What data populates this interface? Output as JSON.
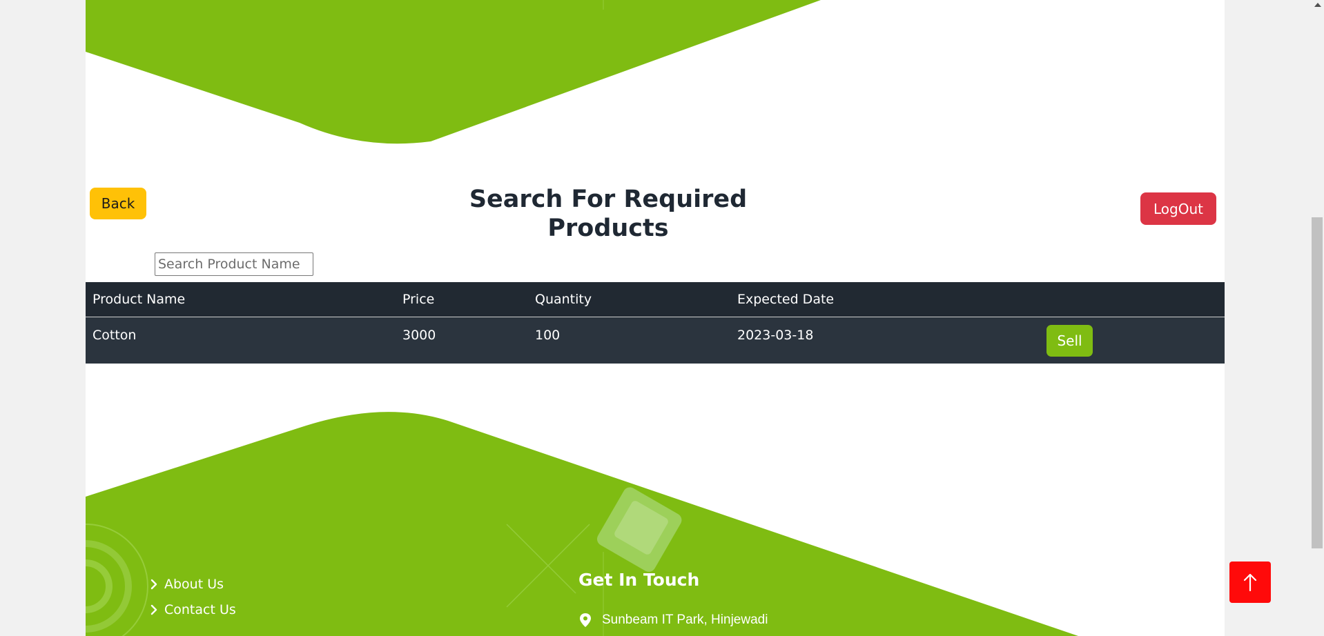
{
  "header": {
    "back_label": "Back",
    "title": "Search For Required Products",
    "logout_label": "LogOut"
  },
  "search": {
    "placeholder": "Search Product Name",
    "value": ""
  },
  "table": {
    "columns": [
      "Product Name",
      "Price",
      "Quantity",
      "Expected Date"
    ],
    "rows": [
      {
        "product": "Cotton",
        "price": "3000",
        "quantity": "100",
        "expected_date": "2023-03-18",
        "action": "Sell"
      }
    ]
  },
  "footer": {
    "links": [
      "About Us",
      "Contact Us"
    ],
    "touch_title": "Get In Touch",
    "address": "Sunbeam IT Park, Hinjewadi"
  },
  "icons": {
    "chevron": "chevron-right-icon",
    "location": "map-pin-icon",
    "scroll_top": "arrow-up-icon"
  },
  "colors": {
    "brand_green": "#7fbc12",
    "back_yellow": "#ffc107",
    "logout_red": "#dc3545",
    "table_header": "#212932",
    "table_row": "#2b343e",
    "scroll_top_red": "#ff0a0a"
  }
}
